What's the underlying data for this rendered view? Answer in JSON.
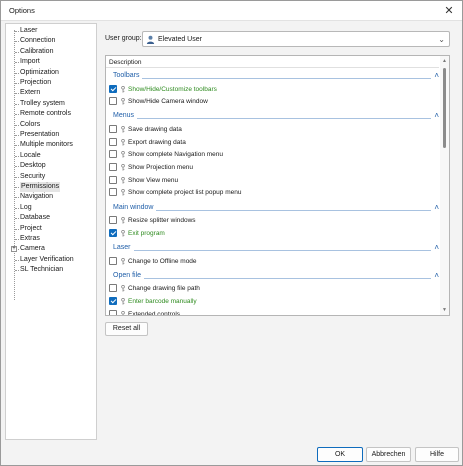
{
  "window": {
    "title": "Options"
  },
  "tree": {
    "items": [
      {
        "label": "Laser"
      },
      {
        "label": "Connection"
      },
      {
        "label": "Calibration"
      },
      {
        "label": "Import"
      },
      {
        "label": "Optimization"
      },
      {
        "label": "Projection"
      },
      {
        "label": "Extern"
      },
      {
        "label": "Trolley system"
      },
      {
        "label": "Remote controls"
      },
      {
        "label": "Colors"
      },
      {
        "label": "Presentation"
      },
      {
        "label": "Multiple monitors"
      },
      {
        "label": "Locale"
      },
      {
        "label": "Desktop"
      },
      {
        "label": "Security"
      },
      {
        "label": "Permissions",
        "selected": true
      },
      {
        "label": "Navigation"
      },
      {
        "label": "Log"
      },
      {
        "label": "Database"
      },
      {
        "label": "Project"
      },
      {
        "label": "Extras"
      },
      {
        "label": "Camera",
        "expandable": true
      },
      {
        "label": "Layer Verification"
      },
      {
        "label": "SL Technician"
      }
    ]
  },
  "user_group": {
    "label": "User group:",
    "value": "Elevated User"
  },
  "permissions": {
    "column_header": "Description",
    "groups": [
      {
        "title": "Toolbars",
        "items": [
          {
            "label": "Show/Hide/Customize toolbars",
            "checked": true
          },
          {
            "label": "Show/Hide Camera window",
            "checked": false
          }
        ]
      },
      {
        "title": "Menus",
        "items": [
          {
            "label": "Save drawing data",
            "checked": false
          },
          {
            "label": "Export drawing data",
            "checked": false
          },
          {
            "label": "Show complete Navigation menu",
            "checked": false
          },
          {
            "label": "Show Projection menu",
            "checked": false
          },
          {
            "label": "Show View menu",
            "checked": false
          },
          {
            "label": "Show complete project list popup menu",
            "checked": false
          }
        ]
      },
      {
        "title": "Main window",
        "items": [
          {
            "label": "Resize splitter windows",
            "checked": false
          },
          {
            "label": "Exit program",
            "checked": true
          }
        ]
      },
      {
        "title": "Laser",
        "items": [
          {
            "label": "Change to Offline mode",
            "checked": false
          }
        ]
      },
      {
        "title": "Open file",
        "items": [
          {
            "label": "Change drawing file path",
            "checked": false
          },
          {
            "label": "Enter barcode manually",
            "checked": true
          },
          {
            "label": "Extended controls",
            "checked": false
          }
        ]
      }
    ]
  },
  "buttons": {
    "reset": "Reset all",
    "ok": "OK",
    "cancel": "Abbrechen",
    "help": "Hilfe"
  },
  "colors": {
    "accent": "#0f6cbd",
    "group_title": "#1f5ea8",
    "enabled_text": "#2e8b1f"
  },
  "icons": {
    "close": "close-icon",
    "user": "user-icon",
    "permission": "key-icon",
    "dropdown": "chevron-down-icon",
    "collapse": "chevron-up-icon"
  }
}
